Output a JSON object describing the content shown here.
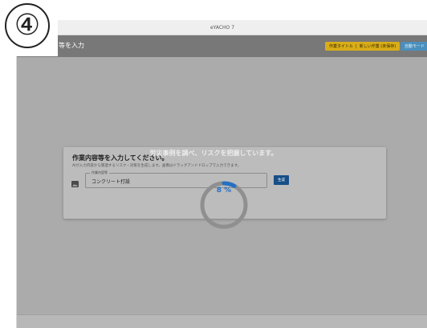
{
  "step_badge": {
    "symbol": "④"
  },
  "window": {
    "title": "eYACHO 7"
  },
  "appbar": {
    "title_partial": "等を入力",
    "task_chip": {
      "label": "作業タイトル",
      "separator": "|",
      "value": "新しい作業 (未保存)"
    },
    "mode_chip": {
      "label": "自動モード"
    }
  },
  "card": {
    "heading": "作業内容等を入力してください。",
    "description": "AIが入力内容から関連するリスク・対策を生成します。画像はドラッグアンドドロップで入力できます。",
    "field": {
      "label": "作業内容等",
      "value": "コンクリート打設"
    },
    "generate_button": "生成"
  },
  "progress": {
    "message": "労災事例を調べ、リスクを把握しています。",
    "percent_label": "8 %",
    "fraction": 0.08
  },
  "colors": {
    "spinner_track": "#8f8f8f",
    "spinner_arc": "#2670c4",
    "task_chip": "#d8ad19",
    "mode_chip": "#4a8fbd",
    "button": "#174e87"
  },
  "icons": {
    "image_icon": "image-icon",
    "step_badge": "circled-number"
  }
}
